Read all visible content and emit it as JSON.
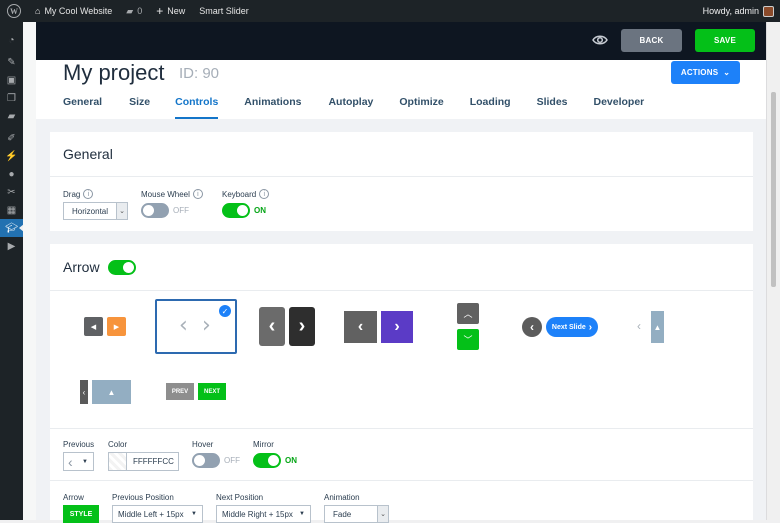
{
  "adminbar": {
    "site_name": "My Cool Website",
    "comments_count": "0",
    "new_label": "New",
    "plugin_label": "Smart Slider",
    "greeting": "Howdy, admin"
  },
  "sidebar": {
    "items": [
      "dashboard-icon",
      "posts-icon",
      "media-icon",
      "pages-icon",
      "comments-icon",
      "appearance-icon",
      "plugins-icon",
      "users-icon",
      "tools-icon",
      "settings-icon",
      "smart-slider-icon",
      "video-icon"
    ],
    "active_index": 10
  },
  "toolbar": {
    "back_label": "BACK",
    "save_label": "SAVE",
    "actions_label": "ACTIONS"
  },
  "project": {
    "title": "My project",
    "id_label": "ID: 90"
  },
  "tabs": [
    {
      "label": "General"
    },
    {
      "label": "Size"
    },
    {
      "label": "Controls",
      "active": true
    },
    {
      "label": "Animations"
    },
    {
      "label": "Autoplay"
    },
    {
      "label": "Optimize"
    },
    {
      "label": "Loading"
    },
    {
      "label": "Slides"
    },
    {
      "label": "Developer"
    }
  ],
  "general": {
    "title": "General",
    "drag_label": "Drag",
    "drag_value": "Horizontal",
    "mousewheel_label": "Mouse Wheel",
    "mousewheel_state": "OFF",
    "keyboard_label": "Keyboard",
    "keyboard_state": "ON"
  },
  "arrow": {
    "title": "Arrow",
    "enabled": true,
    "styles": {
      "next_slide_label": "Next Slide",
      "prev_label": "PREV",
      "next_label": "NEXT"
    },
    "selected_style_index": 1,
    "previous_label": "Previous",
    "color_label": "Color",
    "color_value": "FFFFFFCC",
    "hover_label": "Hover",
    "hover_state": "OFF",
    "mirror_label": "Mirror",
    "mirror_state": "ON",
    "arrow_label": "Arrow",
    "style_button": "STYLE",
    "prev_position_label": "Previous Position",
    "prev_position_value": "Middle Left + 15px",
    "next_position_label": "Next Position",
    "next_position_value": "Middle Right + 15px",
    "animation_label": "Animation",
    "animation_value": "Fade"
  },
  "colors": {
    "save": "#04c018",
    "accent": "#1d81f9",
    "back": "#6b7480",
    "purple": "#5b3bc6",
    "orange": "#f7943c"
  }
}
